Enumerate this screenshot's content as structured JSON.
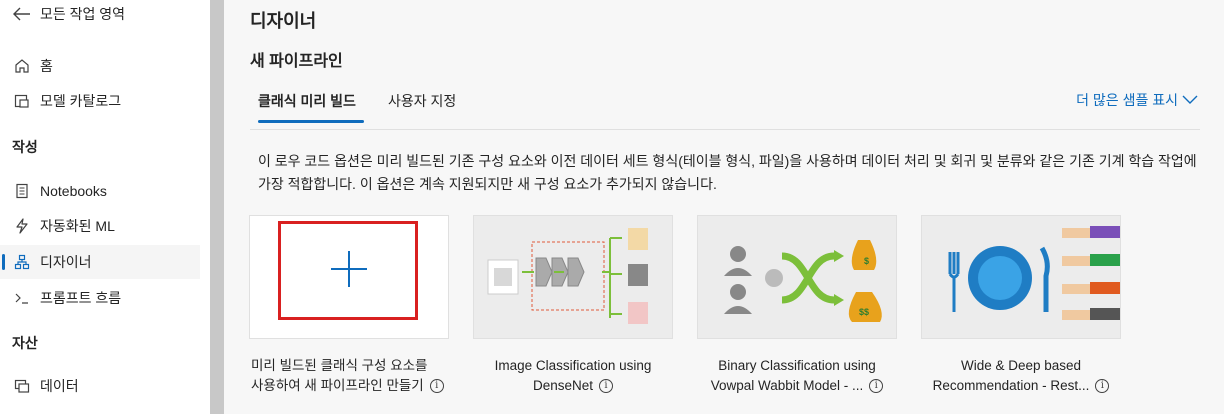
{
  "sidebar": {
    "back": "모든 작업 영역",
    "home": "홈",
    "model_catalog": "모델 카탈로그",
    "section_authoring": "작성",
    "notebooks": "Notebooks",
    "automl": "자동화된 ML",
    "designer": "디자이너",
    "prompt_flow": "프롬프트 흐름",
    "section_assets": "자산",
    "data": "데이터"
  },
  "main": {
    "title": "디자이너",
    "subtitle": "새 파이프라인",
    "tabs": [
      {
        "label": "클래식 미리 빌드",
        "active": true
      },
      {
        "label": "사용자 지정",
        "active": false
      }
    ],
    "more_samples": "더 많은 샘플 표시",
    "description": "이 로우 코드 옵션은 미리 빌드된 기존 구성 요소와 이전 데이터 세트 형식(테이블 형식, 파일)을 사용하며 데이터 처리 및 회귀 및 분류와 같은 기존 기계 학습 작업에 가장 적합합니다. 이 옵션은 계속 지원되지만 새 구성 요소가 추가되지 않습니다.",
    "cards": [
      {
        "line1": "미리 빌드된 클래식 구성 요소를",
        "line2": "사용하여 새 파이프라인 만들기"
      },
      {
        "line1": "Image Classification using",
        "line2": "DenseNet"
      },
      {
        "line1": "Binary Classification using",
        "line2": "Vowpal Wabbit Model - ..."
      },
      {
        "line1": "Wide & Deep based",
        "line2": "Recommendation - Rest..."
      }
    ]
  },
  "colors": {
    "accent": "#0f6cbd",
    "highlight_border": "#d92020",
    "arrow_green": "#7cbf3a",
    "money_bag": "#e8a21c"
  }
}
